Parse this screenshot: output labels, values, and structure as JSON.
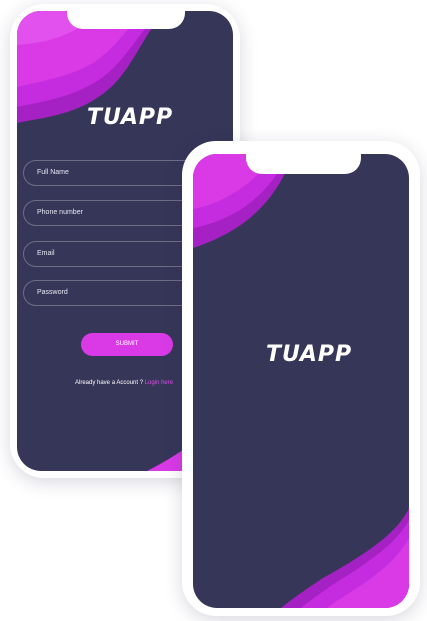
{
  "signup_screen": {
    "logo": "TUAPP",
    "fields": [
      {
        "label": "Full Name"
      },
      {
        "label": "Phone number"
      },
      {
        "label": "Email"
      },
      {
        "label": "Password"
      }
    ],
    "submit_label": "SUBMIT",
    "footer_prompt": "Already have a Account ?",
    "footer_link": "Login here"
  },
  "splash_screen": {
    "logo": "TUAPP"
  },
  "colors": {
    "screen_bg": "#363659",
    "accent_purple": "#d93ae6",
    "accent_light": "#e04ae9"
  }
}
